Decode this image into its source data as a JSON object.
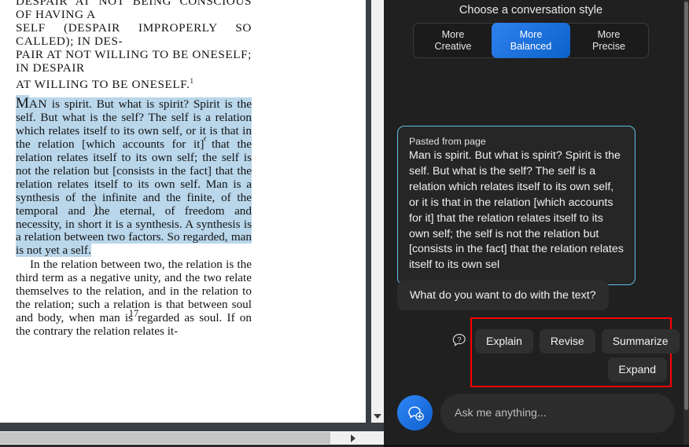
{
  "document": {
    "running_head_lines": [
      "DESPAIR AT NOT BEING CONSCIOUS OF HAVING A",
      "SELF (DESPAIR IMPROPERLY SO CALLED); IN DES-",
      "PAIR AT NOT WILLING TO BE ONESELF; IN DESPAIR",
      "AT WILLING TO BE ONESELF."
    ],
    "footnote_marker": "1",
    "dropcap": "M",
    "paragraph1_smallcaps": "AN",
    "paragraph1": " is spirit. But what is spirit? Spirit is the self. But what is the self? The self is a relation which relates itself to its own self, or it is that in the relation [which accounts for it] that the relation relates itself to its own self; the self is not the relation but [consists in the fact] that the relation relates itself to its own self. Man is a synthesis of the infinite and the finite, of the temporal and the eternal, of freedom and necessity, in short it is a synthesis. A synthesis is a relation between two factors. So regarded, man is not yet a self.",
    "paragraph2": "In the relation between two, the relation is the third term as a negative unity, and the two relate themselves to the relation, and in the relation to the relation; such a relation is that between soul and body, when man is regarded as soul. If on the contrary the relation relates it-",
    "page_number": "17",
    "highlight_color": "#b9d6ea"
  },
  "chat": {
    "style_title": "Choose a conversation style",
    "styles": [
      {
        "line1": "More",
        "line2": "Creative",
        "active": false
      },
      {
        "line1": "More",
        "line2": "Balanced",
        "active": true
      },
      {
        "line1": "More",
        "line2": "Precise",
        "active": false
      }
    ],
    "active_style_color": "#1668d8",
    "pasted": {
      "label": "Pasted from page",
      "text": "Man is spirit. But what is spirit? Spirit is the self. But what is the self? The self is a relation which relates itself to its own self, or it is that in the relation [which accounts for it] that the relation relates itself to its own self; the self is not the relation but [consists in the fact] that the relation relates itself to its own sel",
      "border_color": "#5fc0e8"
    },
    "prompt_bubble": "What do you want to do with the text?",
    "suggestions_row1": [
      "Explain",
      "Revise",
      "Summarize"
    ],
    "suggestions_row2": [
      "Expand"
    ],
    "highlight_rect_color": "#ff0000",
    "composer_placeholder": "Ask me anything...",
    "composer_icon": "chat-plus-icon"
  }
}
